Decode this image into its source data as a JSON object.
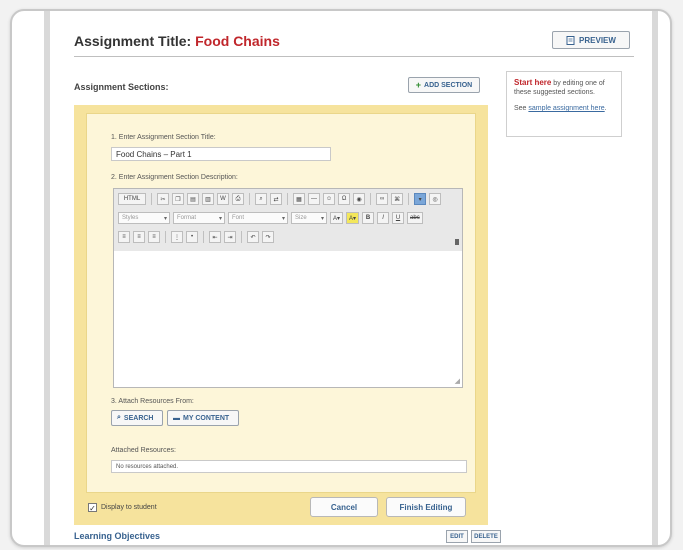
{
  "header": {
    "title_label": "Assignment Title:",
    "title_value": "Food Chains",
    "preview_label": "PREVIEW"
  },
  "sections": {
    "label": "Assignment Sections:",
    "add_label": "ADD SECTION"
  },
  "form": {
    "step1_label": "1. Enter Assignment Section Title:",
    "title_input_value": "Food Chains – Part 1",
    "step2_label": "2. Enter Assignment Section Description:",
    "toolbar": {
      "row1": [
        "HTML",
        "Find",
        "Replace",
        "Link",
        "Unlink",
        "Anchor",
        "Image",
        "Table",
        "Spell"
      ],
      "styles_placeholder": "Styles",
      "format_placeholder": "Format",
      "font_placeholder": "Font",
      "size_placeholder": "Size",
      "bold": "B",
      "italic": "I",
      "underline": "U",
      "strike": "abc"
    },
    "step3_label": "3. Attach Resources From:",
    "search_label": "SEARCH",
    "mycontent_label": "MY CONTENT",
    "attached_label": "Attached Resources:",
    "attached_value": "No resources attached."
  },
  "footer": {
    "display_label": "Display to student",
    "cancel_label": "Cancel",
    "finish_label": "Finish Editing"
  },
  "learning": {
    "label": "Learning Objectives",
    "edit_label": "EDIT",
    "delete_label": "DELETE"
  },
  "sidebar": {
    "start_label": "Start here",
    "start_text": " by editing one of these suggested sections.",
    "see_text": "See ",
    "sample_link": "sample assignment here",
    "period": "."
  },
  "colors": {
    "accent_red": "#c0262b",
    "link_blue": "#38628f",
    "panel_yellow": "#f6e39d"
  }
}
